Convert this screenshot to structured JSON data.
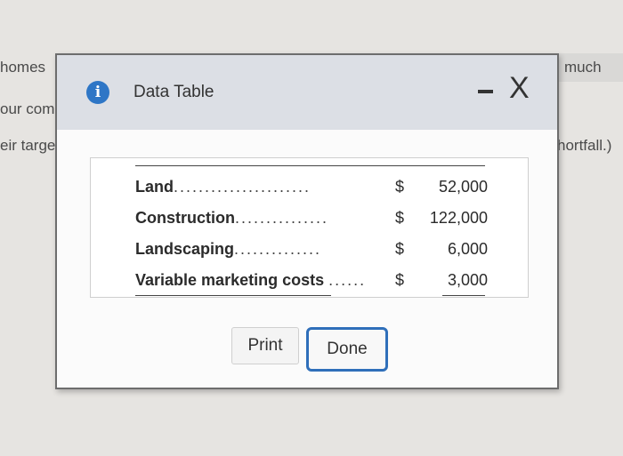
{
  "background": {
    "fragments": {
      "left_1": "homes",
      "left_2": "our comp",
      "left_3": "eir targe",
      "right_1": "much",
      "right_2": "hortfall.)"
    }
  },
  "dialog": {
    "title": "Data Table",
    "rows": [
      {
        "label": "Land",
        "dots": "......................",
        "currency": "$",
        "amount": "52,000"
      },
      {
        "label": "Construction",
        "dots": "...............",
        "currency": "$",
        "amount": "122,000"
      },
      {
        "label": "Landscaping",
        "dots": "..............",
        "currency": "$",
        "amount": "6,000"
      },
      {
        "label": "Variable marketing costs",
        "dots": "......",
        "currency": "$",
        "amount": "3,000"
      }
    ],
    "buttons": {
      "print": "Print",
      "done": "Done"
    },
    "icons": {
      "info": "i",
      "minimize": "minimize-icon",
      "close": "X"
    }
  },
  "colors": {
    "accent": "#2f6fba",
    "info_icon": "#2e76c6"
  }
}
